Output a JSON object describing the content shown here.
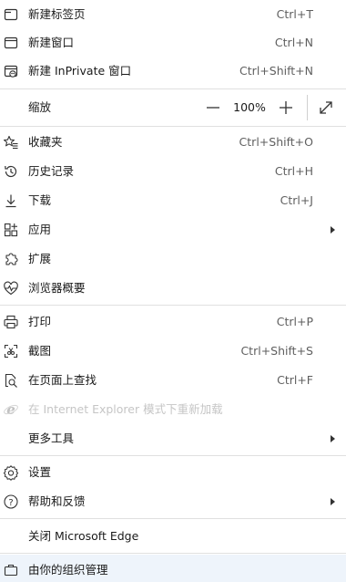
{
  "menu": {
    "new_tab": {
      "label": "新建标签页",
      "shortcut": "Ctrl+T",
      "icon": "new-tab-icon"
    },
    "new_window": {
      "label": "新建窗口",
      "shortcut": "Ctrl+N",
      "icon": "new-window-icon"
    },
    "new_inprivate": {
      "label": "新建 InPrivate 窗口",
      "shortcut": "Ctrl+Shift+N",
      "icon": "inprivate-icon"
    },
    "zoom": {
      "label": "缩放",
      "value": "100%",
      "minus_icon": "minus-icon",
      "plus_icon": "plus-icon",
      "fullscreen_icon": "fullscreen-icon"
    },
    "favorites": {
      "label": "收藏夹",
      "shortcut": "Ctrl+Shift+O",
      "icon": "favorites-icon"
    },
    "history": {
      "label": "历史记录",
      "shortcut": "Ctrl+H",
      "icon": "history-icon"
    },
    "downloads": {
      "label": "下载",
      "shortcut": "Ctrl+J",
      "icon": "download-icon"
    },
    "apps": {
      "label": "应用",
      "icon": "apps-icon"
    },
    "extensions": {
      "label": "扩展",
      "icon": "extensions-icon"
    },
    "browser_essentials": {
      "label": "浏览器概要",
      "icon": "heartbeat-icon"
    },
    "print": {
      "label": "打印",
      "shortcut": "Ctrl+P",
      "icon": "print-icon"
    },
    "screenshot": {
      "label": "截图",
      "shortcut": "Ctrl+Shift+S",
      "icon": "screenshot-icon"
    },
    "find": {
      "label": "在页面上查找",
      "shortcut": "Ctrl+F",
      "icon": "find-icon"
    },
    "ie_mode": {
      "label": "在 Internet Explorer 模式下重新加载",
      "icon": "ie-icon"
    },
    "more_tools": {
      "label": "更多工具"
    },
    "settings": {
      "label": "设置",
      "icon": "settings-icon"
    },
    "help": {
      "label": "帮助和反馈",
      "icon": "help-icon"
    },
    "close_edge": {
      "label": "关闭 Microsoft Edge"
    },
    "managed": {
      "label": "由你的组织管理",
      "icon": "briefcase-icon"
    }
  }
}
